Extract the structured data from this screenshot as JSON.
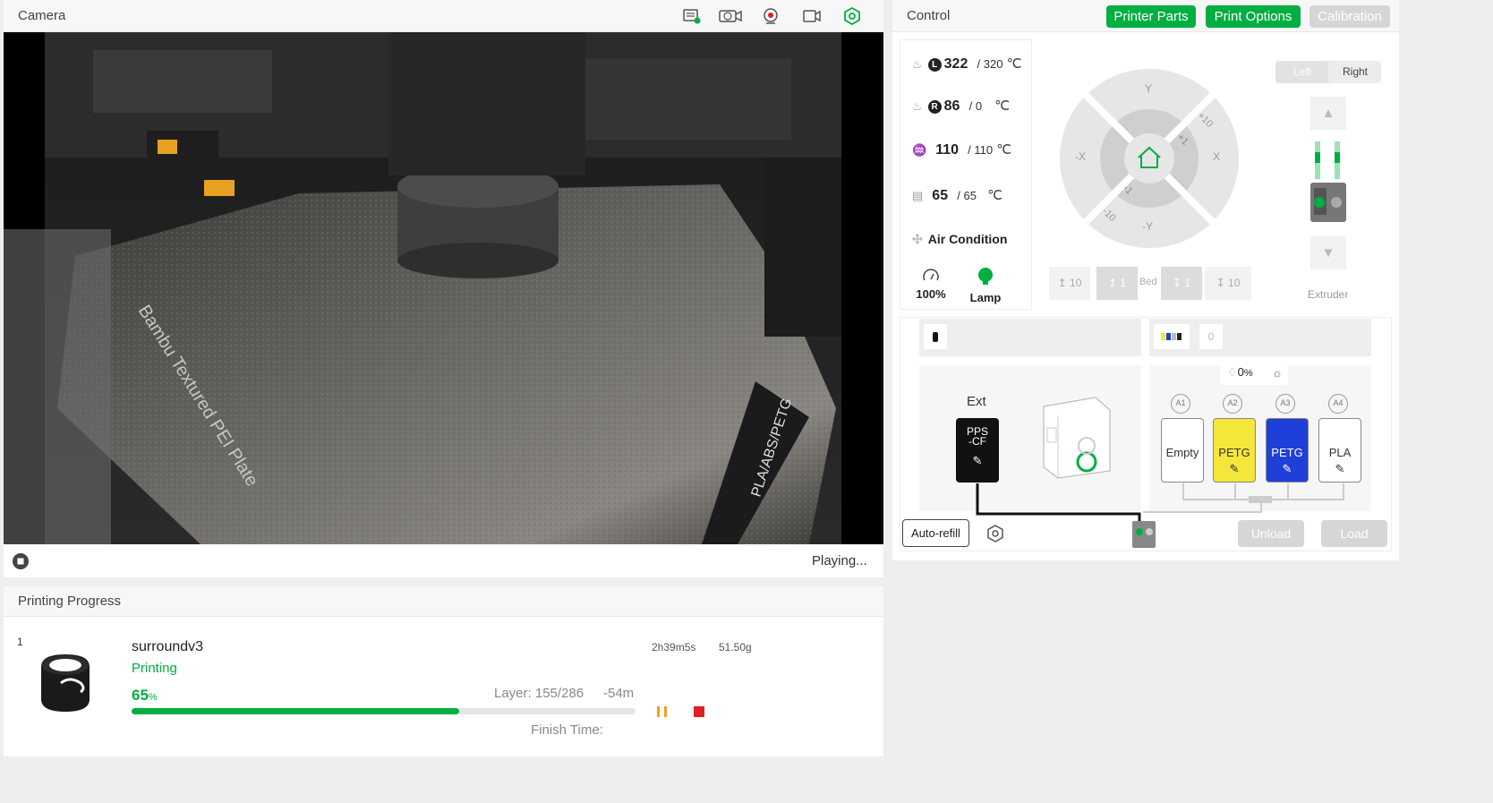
{
  "camera": {
    "title": "Camera",
    "status": "Playing...",
    "icons": [
      "sd-card-icon",
      "timelapse-icon",
      "webcam-icon",
      "recording-icon",
      "settings-gear-icon"
    ]
  },
  "control": {
    "title": "Control",
    "tabs": {
      "printer_parts": "Printer Parts",
      "print_options": "Print Options",
      "calibration": "Calibration"
    },
    "temps": {
      "left_nozzle": {
        "badge": "L",
        "current": "322",
        "target": "/ 320",
        "unit": "℃"
      },
      "right_nozzle": {
        "badge": "R",
        "current": "86",
        "target": "/ 0",
        "unit": "℃"
      },
      "bed": {
        "current": "110",
        "target": "/ 110",
        "unit": "℃"
      },
      "chamber": {
        "current": "65",
        "target": "/ 65",
        "unit": "℃"
      }
    },
    "air_condition": "Air Condition",
    "speed": "100%",
    "lamp": "Lamp",
    "jog": {
      "y_plus": "Y",
      "y_minus": "-Y",
      "x_plus": "X",
      "x_minus": "-X",
      "plus10": "+10",
      "plus1": "+1",
      "minus1": "-1",
      "minus10": "-10"
    },
    "bed_buttons": {
      "up10": "10",
      "up1": "1",
      "label": "Bed",
      "down1": "1",
      "down10": "10"
    },
    "extruder": {
      "left": "Left",
      "right": "Right",
      "label": "Extruder"
    },
    "ams": {
      "ext_label": "Ext",
      "ext_slot": "PPS\n-CF",
      "humidity": "0",
      "humidity_unit": "%",
      "tray_count": "0",
      "slots": [
        {
          "id": "A1",
          "label": "Empty",
          "color": "#ffffff",
          "text": "#333333"
        },
        {
          "id": "A2",
          "label": "PETG",
          "color": "#f5e63a",
          "text": "#333333"
        },
        {
          "id": "A3",
          "label": "PETG",
          "color": "#1f3fd9",
          "text": "#ffffff"
        },
        {
          "id": "A4",
          "label": "PLA",
          "color": "#ffffff",
          "text": "#333333"
        }
      ],
      "auto_refill": "Auto-refill",
      "unload": "Unload",
      "load": "Load"
    }
  },
  "progress": {
    "title": "Printing Progress",
    "plate": "1",
    "name": "surroundv3",
    "status": "Printing",
    "percent": "65",
    "percent_value": 65,
    "percent_unit": "%",
    "layer": "Layer: 155/286",
    "remaining": "-54m",
    "total_time": "2h39m5s",
    "weight": "51.50g",
    "finish_time": "Finish Time:"
  },
  "colors": {
    "accent": "#00ae42",
    "stop": "#e02020",
    "pause": "#f0a020"
  }
}
